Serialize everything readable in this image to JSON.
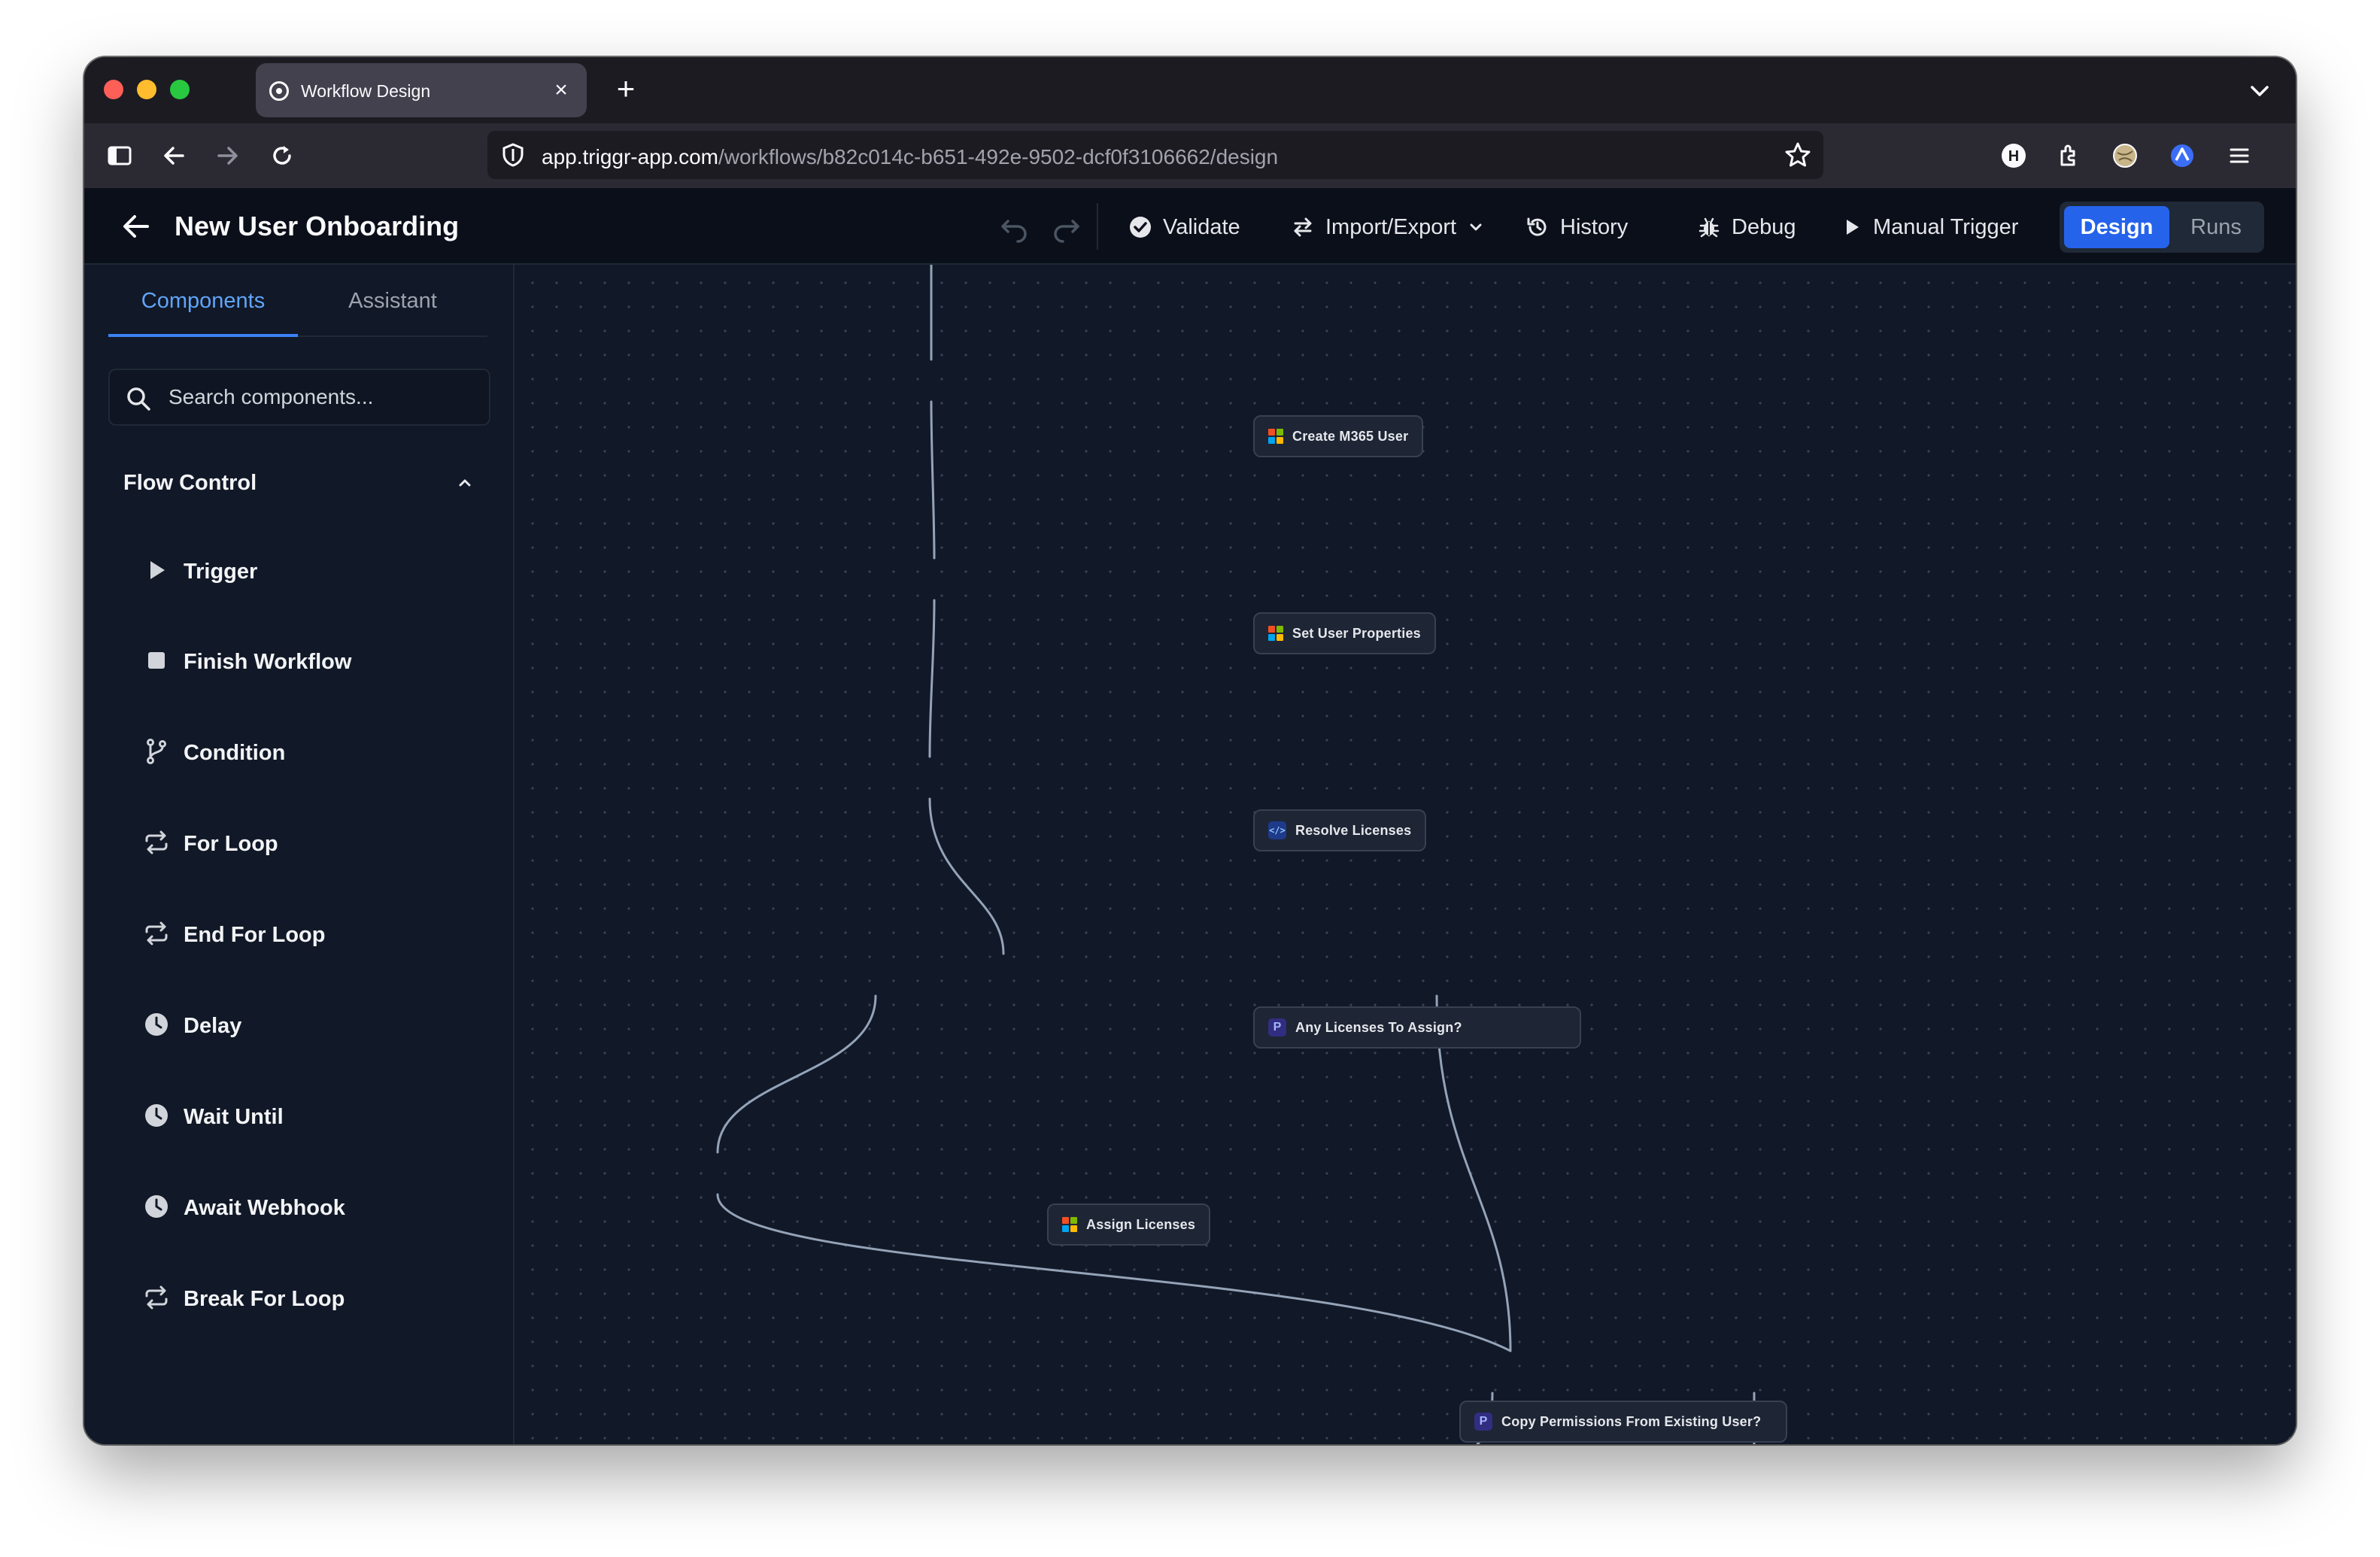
{
  "browser": {
    "tab_title": "Workflow Design",
    "tab_close": "×",
    "new_tab": "+",
    "url_host": "app.triggr-app.com",
    "url_path": "/workflows/b82c014c-b651-492e-9502-dcf0f3106662/design",
    "url_prefix": "",
    "profile_initial": "H"
  },
  "header": {
    "title": "New User Onboarding",
    "validate": "Validate",
    "import_export": "Import/Export",
    "history": "History",
    "debug": "Debug",
    "manual_trigger": "Manual Trigger",
    "design": "Design",
    "runs": "Runs"
  },
  "sidebar": {
    "tabs": [
      "Components",
      "Assistant"
    ],
    "search_placeholder": "Search components...",
    "section_title": "Flow Control",
    "items": [
      {
        "label": "Trigger",
        "icon": "play-icon"
      },
      {
        "label": "Finish Workflow",
        "icon": "stop-icon"
      },
      {
        "label": "Condition",
        "icon": "git-branch-icon"
      },
      {
        "label": "For Loop",
        "icon": "repeat-icon"
      },
      {
        "label": "End For Loop",
        "icon": "repeat-icon"
      },
      {
        "label": "Delay",
        "icon": "clock-icon"
      },
      {
        "label": "Wait Until",
        "icon": "clock-icon"
      },
      {
        "label": "Await Webhook",
        "icon": "clock-icon"
      },
      {
        "label": "Break For Loop",
        "icon": "repeat-icon"
      }
    ]
  },
  "canvas": {
    "nodes": [
      {
        "label": "Create M365 User",
        "icon": "microsoft-icon"
      },
      {
        "label": "Set User Properties",
        "icon": "microsoft-icon"
      },
      {
        "label": "Resolve Licenses",
        "icon": "code-icon"
      },
      {
        "label": "Any Licenses To Assign?",
        "icon": "condition-icon"
      },
      {
        "label": "Assign Licenses",
        "icon": "microsoft-icon"
      },
      {
        "label": "Copy Permissions From Existing User?",
        "icon": "condition-icon"
      }
    ],
    "condition_glyph": "P",
    "code_glyph": "</>"
  },
  "colors": {
    "accent": "#2563eb",
    "tab_active": "#60a5fa",
    "canvas_bg": "#111827",
    "edge": "#94a3b8"
  }
}
